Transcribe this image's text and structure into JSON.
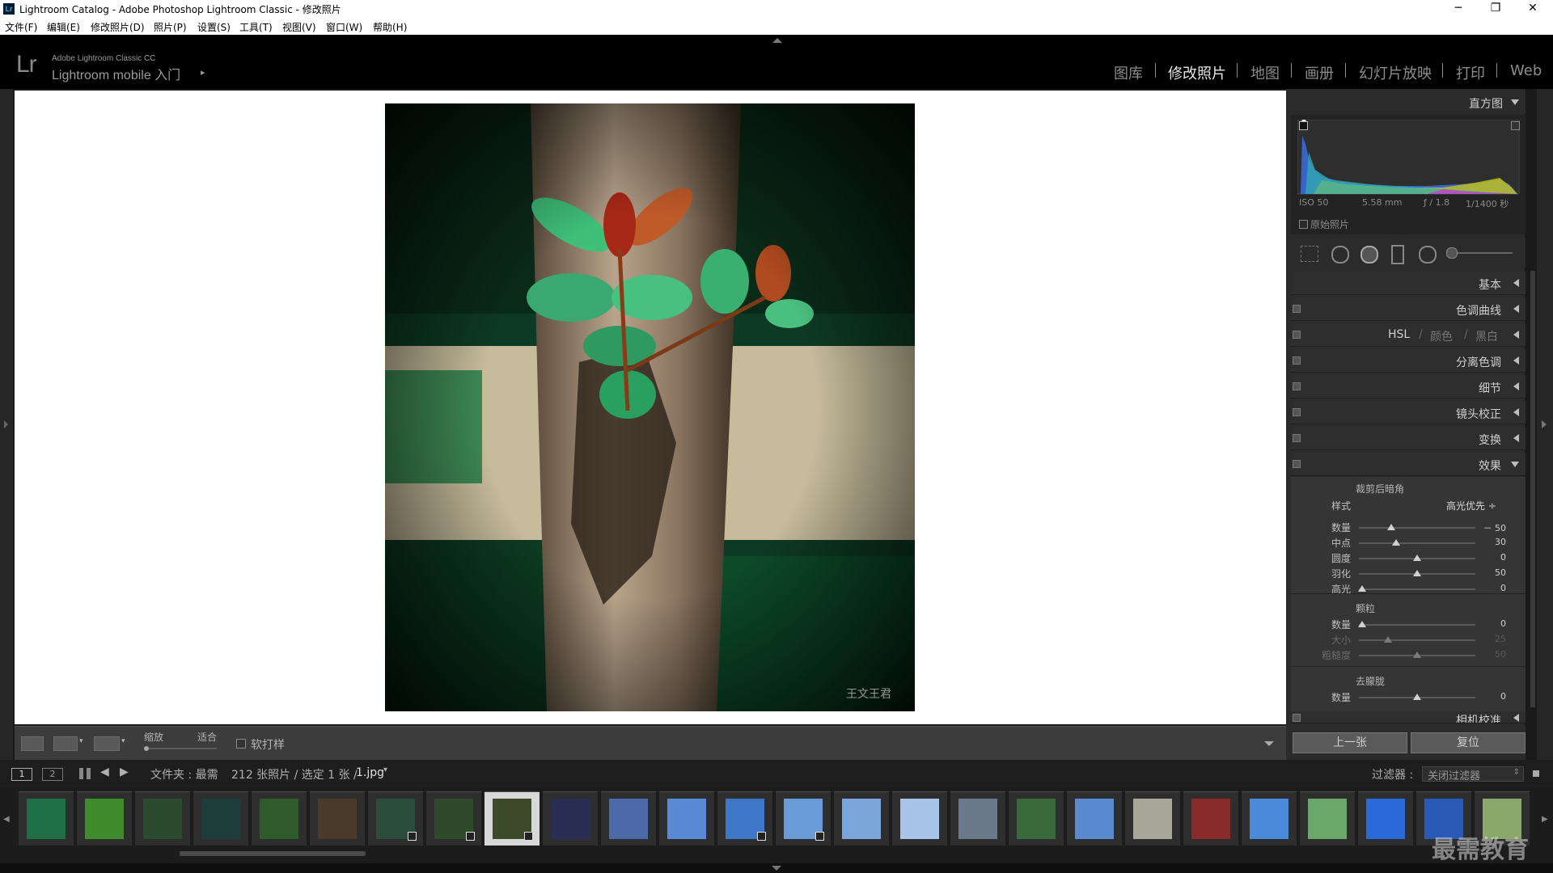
{
  "window": {
    "app_icon_text": "Lr",
    "title": "Lightroom Catalog - Adobe Photoshop Lightroom Classic - 修改照片",
    "controls": [
      "─",
      "❐",
      "✕"
    ]
  },
  "menu": [
    "文件(F)",
    "编辑(E)",
    "修改照片(D)",
    "照片(P)",
    "设置(S)",
    "工具(T)",
    "视图(V)",
    "窗口(W)",
    "帮助(H)"
  ],
  "identity": {
    "logo": "Lr",
    "small": "Adobe Lightroom Classic CC",
    "big": "Lightroom mobile 入门",
    "arrow": "▸"
  },
  "modules": [
    {
      "label": "图库",
      "active": false
    },
    {
      "label": "修改照片",
      "active": true
    },
    {
      "label": "地图",
      "active": false
    },
    {
      "label": "画册",
      "active": false
    },
    {
      "label": "幻灯片放映",
      "active": false
    },
    {
      "label": "打印",
      "active": false
    },
    {
      "label": "Web",
      "active": false
    }
  ],
  "photo": {
    "signature": "王文王君"
  },
  "toolbar": {
    "zoom_label": "缩放",
    "fit_label": "适合",
    "softproof_label": "软打样"
  },
  "histogram": {
    "title": "直方图",
    "iso": "ISO 50",
    "focal": "5.58 mm",
    "aperture": "ƒ / 1.8",
    "shutter": "1/1400 秒",
    "original_label": "原始照片"
  },
  "panels": {
    "basic": "基本",
    "tone_curve": "色调曲线",
    "hsl": "HSL",
    "hsl_color": "颜色",
    "hsl_bw": "黑白",
    "split_toning": "分离色调",
    "detail": "细节",
    "lens": "镜头校正",
    "transform": "变换",
    "effects": "效果",
    "calibration": "相机校准"
  },
  "effects": {
    "vignette_title": "裁剪后暗角",
    "style_label": "样式",
    "style_value": "高光优先 ÷",
    "vignette": [
      {
        "label": "数量",
        "value": "－ 50",
        "pos": 0.28,
        "dim": false
      },
      {
        "label": "中点",
        "value": "30",
        "pos": 0.32,
        "dim": false
      },
      {
        "label": "圆度",
        "value": "0",
        "pos": 0.5,
        "dim": false
      },
      {
        "label": "羽化",
        "value": "50",
        "pos": 0.5,
        "dim": false
      },
      {
        "label": "高光",
        "value": "0",
        "pos": 0.03,
        "dim": false
      }
    ],
    "grain_title": "颗粒",
    "grain": [
      {
        "label": "数量",
        "value": "0",
        "pos": 0.03,
        "dim": false
      },
      {
        "label": "大小",
        "value": "25",
        "pos": 0.25,
        "dim": true
      },
      {
        "label": "粗糙度",
        "value": "50",
        "pos": 0.5,
        "dim": true
      }
    ],
    "dehaze_title": "去朦胧",
    "dehaze": [
      {
        "label": "数量",
        "value": "0",
        "pos": 0.5,
        "dim": false
      }
    ]
  },
  "buttons": {
    "prev": "上一张",
    "reset": "复位"
  },
  "filmstrip_bar": {
    "monitor1": "1",
    "monitor2": "2",
    "source": "文件夹 : 最需",
    "count": "212 张照片 / 选定 1 张 /",
    "filename": "1.jpg",
    "filter_label": "过滤器 :",
    "filter_value": "关闭过滤器"
  },
  "filmstrip": {
    "selected_index": 8,
    "thumbs": [
      {
        "color": "#1f6e45",
        "badge": false
      },
      {
        "color": "#3f8a2a",
        "badge": false
      },
      {
        "color": "#2b4a30",
        "badge": false
      },
      {
        "color": "#1e3c3a",
        "badge": false
      },
      {
        "color": "#2f5a2c",
        "badge": false
      },
      {
        "color": "#4a3a2c",
        "badge": false
      },
      {
        "color": "#2c4d3c",
        "badge": true
      },
      {
        "color": "#2e4a2a",
        "badge": true
      },
      {
        "color": "#3c4a2a",
        "badge": true
      },
      {
        "color": "#2a2e55",
        "badge": false
      },
      {
        "color": "#4c6aa8",
        "badge": false
      },
      {
        "color": "#5a8ad6",
        "badge": false
      },
      {
        "color": "#3e76c8",
        "badge": true
      },
      {
        "color": "#6a9ad8",
        "badge": true
      },
      {
        "color": "#7aa6dc",
        "badge": false
      },
      {
        "color": "#a8c4e8",
        "badge": false
      },
      {
        "color": "#6a7a8a",
        "badge": false
      },
      {
        "color": "#3a6a3c",
        "badge": false
      },
      {
        "color": "#5a8ad0",
        "badge": false
      },
      {
        "color": "#a8a89a",
        "badge": false
      },
      {
        "color": "#8a2a2a",
        "badge": false
      },
      {
        "color": "#4a8ad8",
        "badge": false
      },
      {
        "color": "#6aa86a",
        "badge": false
      },
      {
        "color": "#2a6ad8",
        "badge": false
      },
      {
        "color": "#2a5ab8",
        "badge": false
      },
      {
        "color": "#8aa86a",
        "badge": false
      }
    ]
  },
  "watermark": "最需教育"
}
